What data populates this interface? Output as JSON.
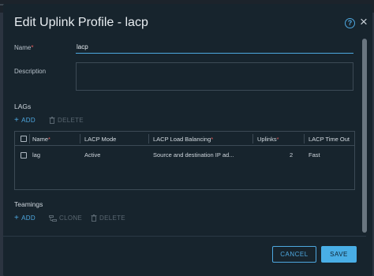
{
  "dialog": {
    "title": "Edit Uplink Profile - lacp",
    "help_icon": "question-circle-icon",
    "close_icon": "close-icon",
    "help_glyph": "?",
    "close_glyph": "×"
  },
  "form": {
    "name_label": "Name",
    "name_required": "*",
    "name_value": "lacp",
    "description_label": "Description",
    "description_value": ""
  },
  "lags": {
    "section_title": "LAGs",
    "add_label": "ADD",
    "delete_label": "DELETE",
    "columns": {
      "name": "Name",
      "name_required": "*",
      "lacp_mode": "LACP Mode",
      "lacp_load_balancing": "LACP Load Balancing",
      "lacp_load_balancing_required": "*",
      "uplinks": "Uplinks",
      "uplinks_required": "*",
      "lacp_timeout": "LACP Time Out"
    },
    "rows": [
      {
        "name": "lag",
        "lacp_mode": "Active",
        "lacp_load_balancing": "Source and destination IP ad...",
        "uplinks": "2",
        "lacp_timeout": "Fast"
      }
    ]
  },
  "teamings": {
    "section_title": "Teamings",
    "add_label": "ADD",
    "clone_label": "CLONE",
    "delete_label": "DELETE"
  },
  "footer": {
    "cancel_label": "CANCEL",
    "save_label": "SAVE"
  },
  "colors": {
    "accent": "#4ea8e0",
    "dialog_bg": "#17242d",
    "required": "#e05a5a"
  }
}
